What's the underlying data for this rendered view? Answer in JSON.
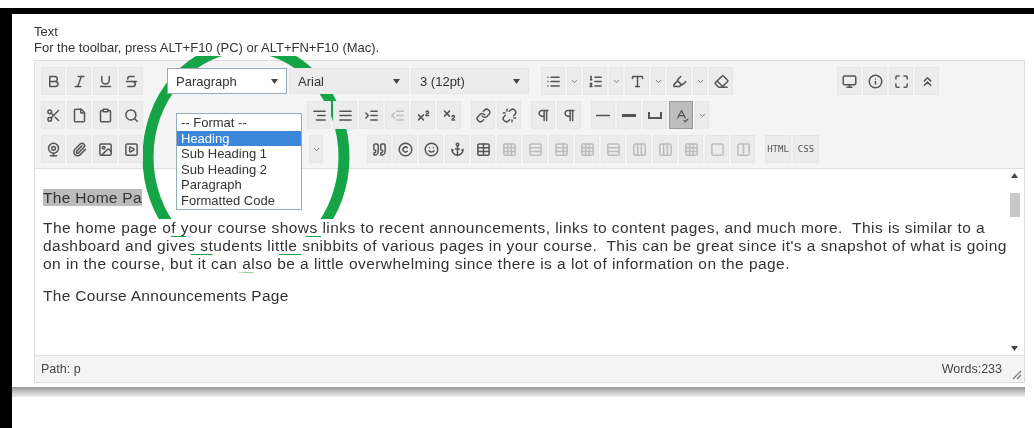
{
  "field_label": "Text",
  "instructions": "For the toolbar, press ALT+F10 (PC) or ALT+FN+F10 (Mac).",
  "toolbar": {
    "format_select": {
      "value": "Paragraph"
    },
    "font_select": {
      "value": "Arial"
    },
    "size_select": {
      "value": "3 (12pt)"
    },
    "spellcheck": {
      "on": true
    },
    "code_buttons": [
      "HTML",
      "CSS"
    ]
  },
  "format_menu": {
    "items": [
      {
        "label": "-- Format --",
        "selected": false
      },
      {
        "label": "Heading",
        "selected": true
      },
      {
        "label": "Sub Heading 1",
        "selected": false
      },
      {
        "label": "Sub Heading 2",
        "selected": false
      },
      {
        "label": "Paragraph",
        "selected": false
      },
      {
        "label": "Formatted Code",
        "selected": false
      }
    ]
  },
  "content": [
    {
      "kind": "heading",
      "text": "The Home Pa",
      "selected": true
    },
    {
      "kind": "paragraph",
      "text": "The home page of your course shows links to recent announcements, links to content pages, and much more.  This is similar to a dashboard and gives students little snibbits of various pages in your course.  This can be great since it's a snapshot of what is going on in the course, but it can also be a little overwhelming since there is a lot of information on the page.",
      "selected": false
    },
    {
      "kind": "heading",
      "text": "The Course Announcements Page",
      "selected": false
    }
  ],
  "status_bar": {
    "path": "Path: p",
    "words": "Words:233"
  }
}
